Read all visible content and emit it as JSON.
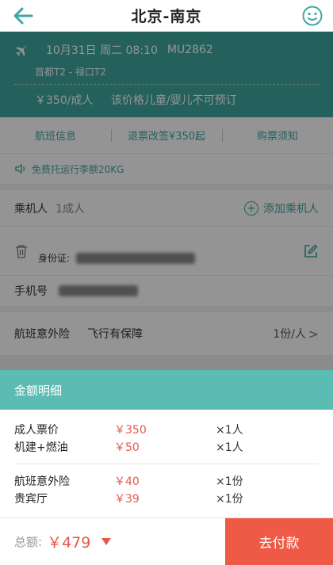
{
  "header": {
    "title": "北京-南京"
  },
  "flight": {
    "datetime": "10月31日 周二 08:10",
    "flight_no": "MU2862",
    "route": "首都T2 - 禄口T2",
    "price": "￥350/成人",
    "note": "该价格儿童/婴儿不可预订"
  },
  "tabs": [
    "航班信息",
    "退票改签¥350起",
    "购票须知"
  ],
  "baggage": "免费托运行李额20KG",
  "passenger": {
    "label": "乘机人",
    "count": "1成人",
    "add": "添加乘机人",
    "id_label": "身份证:"
  },
  "phone_label": "手机号",
  "insurance": {
    "label": "航班意外险",
    "name": "飞行有保障",
    "qty": "1份/人",
    "chevron": ">"
  },
  "fees": {
    "title": "金额明细",
    "group1": [
      {
        "name": "成人票价",
        "price": "￥350",
        "qty": "×1人"
      },
      {
        "name": "机建+燃油",
        "price": "￥50",
        "qty": "×1人"
      }
    ],
    "group2": [
      {
        "name": "航班意外险",
        "price": "￥40",
        "qty": "×1份"
      },
      {
        "name": "贵宾厅",
        "price": "￥39",
        "qty": "×1份"
      }
    ]
  },
  "footer": {
    "total_label": "总额:",
    "total_value": "￥479",
    "pay": "去付款"
  },
  "colors": {
    "accent": "#3ea8a0",
    "price": "#e8574a",
    "pay": "#ef5a47"
  }
}
